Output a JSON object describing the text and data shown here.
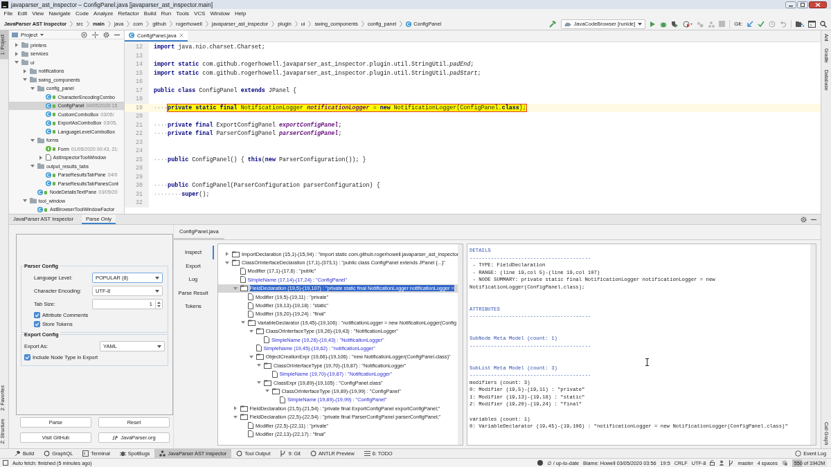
{
  "window": {
    "title": "javaparser_ast_inspector – ConfigPanel.java [javaparser_ast_inspector.main]"
  },
  "menu": [
    "File",
    "Edit",
    "View",
    "Navigate",
    "Code",
    "Analyze",
    "Refactor",
    "Build",
    "Run",
    "Tools",
    "VCS",
    "Window",
    "Help"
  ],
  "breadcrumb": [
    {
      "label": "JavaParser AST Inspector",
      "kind": "module",
      "bold": true
    },
    {
      "label": "src",
      "kind": "folder",
      "bold": false
    },
    {
      "label": "main",
      "kind": "folder",
      "bold": true
    },
    {
      "label": "java",
      "kind": "folder",
      "bold": false
    },
    {
      "label": "com",
      "kind": "folder",
      "bold": false
    },
    {
      "label": "github",
      "kind": "folder",
      "bold": false
    },
    {
      "label": "rogerhowell",
      "kind": "folder",
      "bold": false
    },
    {
      "label": "javaparser_ast_inspector",
      "kind": "folder",
      "bold": false
    },
    {
      "label": "plugin",
      "kind": "folder",
      "bold": false
    },
    {
      "label": "ui",
      "kind": "folder",
      "bold": false
    },
    {
      "label": "swing_components",
      "kind": "folder",
      "bold": false
    },
    {
      "label": "config_panel",
      "kind": "folder",
      "bold": false
    },
    {
      "label": "ConfigPanel",
      "kind": "class",
      "bold": false
    }
  ],
  "toolbar": {
    "run_config": "JavaCodeBrowser [runIde]",
    "git_label": "Git:"
  },
  "left_stripe": {
    "top": [
      {
        "label": "1: Project",
        "selected": true
      }
    ],
    "bottom": [
      {
        "label": "2: Favorites",
        "selected": false
      },
      {
        "label": "Z: Structure",
        "selected": false
      }
    ]
  },
  "right_stripe": {
    "top": [
      "Ant",
      "Gradle",
      "Database"
    ],
    "bottom": [
      "Call Graph"
    ]
  },
  "project": {
    "title": "Project",
    "tree": [
      {
        "name": "printers",
        "kind": "folder",
        "expanded": false,
        "selected": false
      },
      {
        "name": "services",
        "kind": "folder",
        "expanded": false,
        "selected": false
      },
      {
        "name": "ui",
        "kind": "folder",
        "expanded": true,
        "selected": false,
        "children": [
          {
            "name": "notifications",
            "kind": "folder",
            "expanded": false,
            "selected": false
          },
          {
            "name": "swing_components",
            "kind": "folder",
            "expanded": true,
            "selected": false,
            "children": [
              {
                "name": "config_panel",
                "kind": "folder",
                "expanded": true,
                "selected": false,
                "children": [
                  {
                    "name": "CharacterEncodingCombo",
                    "kind": "class",
                    "selected": false
                  },
                  {
                    "name": "ConfigPanel",
                    "meta": "04/05/2020 15",
                    "kind": "class",
                    "selected": true
                  },
                  {
                    "name": "CustomComboBox",
                    "meta": "03/05/",
                    "kind": "class",
                    "selected": false
                  },
                  {
                    "name": "ExportAsComboBox",
                    "meta": "03/05,",
                    "kind": "class",
                    "selected": false
                  },
                  {
                    "name": "LanguageLevelComboBox",
                    "kind": "class",
                    "selected": false
                  }
                ]
              },
              {
                "name": "forms",
                "kind": "folder",
                "expanded": true,
                "selected": false,
                "children": [
                  {
                    "name": "Form",
                    "meta": "01/05/2020 00:43, 21:",
                    "kind": "form",
                    "selected": false
                  },
                  {
                    "name": "AstInspectorToolWindow",
                    "kind": "file",
                    "expanded": false,
                    "selected": false
                  }
                ]
              },
              {
                "name": "output_results_tabs",
                "kind": "folder",
                "expanded": true,
                "selected": false,
                "children": [
                  {
                    "name": "ParseResultsTabPane",
                    "meta": "04/0",
                    "kind": "class",
                    "selected": false
                  },
                  {
                    "name": "ParseResultsTabPanesCont",
                    "kind": "class",
                    "selected": false
                  }
                ]
              },
              {
                "name": "NodeDetailsTextPane",
                "meta": "03/05/20",
                "kind": "class",
                "selected": false
              }
            ]
          },
          {
            "name": "tool_window",
            "kind": "folder",
            "expanded": true,
            "selected": false,
            "children": [
              {
                "name": "AstBrowserToolWindowFactor",
                "kind": "class",
                "selected": false
              }
            ]
          }
        ]
      }
    ]
  },
  "editor": {
    "tab": "ConfigPanel.java",
    "lines": [
      {
        "number": "12",
        "highlighted": false,
        "tokens": [
          {
            "kind": "keyword",
            "text": "import"
          },
          {
            "kind": "plain",
            "text": " java.nio.charset.Charset;"
          }
        ]
      },
      {
        "number": "13",
        "highlighted": false
      },
      {
        "number": "14",
        "highlighted": false,
        "tokens": [
          {
            "kind": "keyword",
            "text": "import static"
          },
          {
            "kind": "plain",
            "text": " com.github.rogerhowell.javaparser_ast_inspector.plugin.util.StringUtil."
          },
          {
            "kind": "static",
            "text": "padEnd"
          },
          {
            "kind": "plain",
            "text": ";"
          }
        ]
      },
      {
        "number": "15",
        "highlighted": false,
        "tokens": [
          {
            "kind": "keyword",
            "text": "import static"
          },
          {
            "kind": "plain",
            "text": " com.github.rogerhowell.javaparser_ast_inspector.plugin.util.StringUtil."
          },
          {
            "kind": "static",
            "text": "padStart"
          },
          {
            "kind": "plain",
            "text": ";"
          }
        ]
      },
      {
        "number": "16",
        "highlighted": false
      },
      {
        "number": "17",
        "highlighted": false,
        "tokens": [
          {
            "kind": "keyword",
            "text": "public class"
          },
          {
            "kind": "plain",
            "text": " ConfigPanel "
          },
          {
            "kind": "keyword",
            "text": "extends"
          },
          {
            "kind": "plain",
            "text": " JPanel {"
          }
        ]
      },
      {
        "number": "18",
        "highlighted": false
      },
      {
        "number": "19",
        "highlighted": true,
        "tokens": [
          {
            "kind": "indent",
            "text": "····"
          },
          {
            "kind": "keyword",
            "text": "private static final"
          },
          {
            "kind": "plain",
            "text": " NotificationLogger "
          },
          {
            "kind": "field",
            "text": "notificationLogger"
          },
          {
            "kind": "plain",
            "text": " = "
          },
          {
            "kind": "keyword",
            "text": "new"
          },
          {
            "kind": "plain",
            "text": " NotificationLogger(ConfigPanel."
          },
          {
            "kind": "keyword",
            "text": "class"
          },
          {
            "kind": "plain",
            "text": ");"
          }
        ]
      },
      {
        "number": "20",
        "highlighted": false
      },
      {
        "number": "21",
        "highlighted": false,
        "tokens": [
          {
            "kind": "indent",
            "text": "····"
          },
          {
            "kind": "keyword",
            "text": "private final"
          },
          {
            "kind": "plain",
            "text": " ExportConfigPanel "
          },
          {
            "kind": "field",
            "text": "exportConfigPanel"
          },
          {
            "kind": "plain",
            "text": ";"
          }
        ]
      },
      {
        "number": "22",
        "highlighted": false,
        "tokens": [
          {
            "kind": "indent",
            "text": "····"
          },
          {
            "kind": "keyword",
            "text": "private final"
          },
          {
            "kind": "plain",
            "text": " ParserConfigPanel "
          },
          {
            "kind": "field",
            "text": "parserConfigPanel"
          },
          {
            "kind": "plain",
            "text": ";"
          }
        ]
      },
      {
        "number": "23",
        "highlighted": false
      },
      {
        "number": "24",
        "highlighted": false
      },
      {
        "number": "25",
        "highlighted": false,
        "tokens": [
          {
            "kind": "indent",
            "text": "····"
          },
          {
            "kind": "keyword",
            "text": "public"
          },
          {
            "kind": "plain",
            "text": " ConfigPanel() { "
          },
          {
            "kind": "keyword",
            "text": "this"
          },
          {
            "kind": "plain",
            "text": "("
          },
          {
            "kind": "keyword",
            "text": "new"
          },
          {
            "kind": "plain",
            "text": " ParserConfiguration()); }"
          }
        ]
      },
      {
        "number": "28",
        "highlighted": false
      },
      {
        "number": "29",
        "highlighted": false
      },
      {
        "number": "30",
        "highlighted": false,
        "tokens": [
          {
            "kind": "indent",
            "text": "····"
          },
          {
            "kind": "keyword",
            "text": "public"
          },
          {
            "kind": "plain",
            "text": " ConfigPanel(ParserConfiguration parserConfiguration) {"
          }
        ]
      },
      {
        "number": "31",
        "highlighted": false,
        "tokens": [
          {
            "kind": "indent",
            "text": "········"
          },
          {
            "kind": "keyword",
            "text": "super"
          },
          {
            "kind": "plain",
            "text": "();"
          }
        ]
      },
      {
        "number": "32",
        "highlighted": false
      }
    ]
  },
  "tool_window": {
    "tabs": [
      {
        "label": "JavaParser AST Inspector",
        "selected": false
      },
      {
        "label": "Parse Only",
        "selected": true
      }
    ]
  },
  "config": {
    "groups": [
      {
        "title": "Parser Config",
        "kind": "parser",
        "fields": [
          {
            "kind": "dropdown",
            "label": "Language Level:",
            "value": "POPULAR (8)",
            "focused": true
          },
          {
            "kind": "dropdown",
            "label": "Character Encoding:",
            "value": "UTF-8",
            "focused": false
          },
          {
            "kind": "spinner",
            "label": "Tab Size:",
            "value": "1",
            "focused": false
          }
        ],
        "checkboxes": [
          {
            "label": "Attribute Comments",
            "checked": true
          },
          {
            "label": "Store Tokens",
            "checked": true
          }
        ]
      },
      {
        "title": "Export Config",
        "kind": "export",
        "fields": [
          {
            "kind": "dropdown",
            "label": "Export As:",
            "value": "YAML",
            "focused": false
          }
        ],
        "checkboxes": [
          {
            "label": "Include Node Type in Export",
            "checked": true
          }
        ]
      }
    ],
    "buttons": [
      {
        "label": "Parse",
        "has_icon": false
      },
      {
        "label": "Reset",
        "has_icon": false
      },
      {
        "label": "Visit GitHub",
        "has_icon": false
      },
      {
        "label": "JavaParser.org",
        "has_icon": true
      }
    ]
  },
  "inspector": {
    "file_tab": "ConfigPanel.java",
    "tabs": [
      {
        "label": "Inspect",
        "selected": true
      },
      {
        "label": "Export",
        "selected": false
      },
      {
        "label": "Log",
        "selected": false
      },
      {
        "label": "Parse Result",
        "selected": false
      },
      {
        "label": "Tokens",
        "selected": false
      }
    ],
    "tree": [
      {
        "label": "ImportDeclaration (15,1)-(15,94) : \"import static com.github.rogerhowell.javaparser_ast_inspector",
        "kind": "node",
        "expanded": false,
        "selected": false
      },
      {
        "label": "ClassOrInterfaceDeclaration (17,1)-(373,1) : \"public class ConfigPanel extends JPanel {...}\"",
        "kind": "node",
        "expanded": true,
        "selected": false,
        "children": [
          {
            "label": "Modifier (17,1)-(17,6) : \"public\"",
            "kind": "leaf",
            "selected": false
          },
          {
            "label": "SimpleName (17,14)-(17,24) : \"ConfigPanel\"",
            "kind": "name",
            "selected": false
          },
          {
            "label": "FieldDeclaration (19,5)-(19,107) : \"private static final NotificationLogger notificationLogger =",
            "kind": "node",
            "expanded": true,
            "selected": true,
            "children": [
              {
                "label": "Modifier (19,5)-(19,11) : \"private\"",
                "kind": "leaf",
                "selected": false
              },
              {
                "label": "Modifier (19,13)-(19,18) : \"static\"",
                "kind": "leaf",
                "selected": false
              },
              {
                "label": "Modifier (19,20)-(19,24) : \"final\"",
                "kind": "leaf",
                "selected": false
              },
              {
                "label": "VariableDeclarator (19,45)-(19,106) : \"notificationLogger = new NotificationLogger(Config",
                "kind": "node",
                "expanded": true,
                "selected": false,
                "children": [
                  {
                    "label": "ClassOrInterfaceType (19,26)-(19,43) : \"NotificationLogger\"",
                    "kind": "node",
                    "expanded": true,
                    "selected": false,
                    "children": [
                      {
                        "label": "SimpleName (19,26)-(19,43) : \"NotificationLogger\"",
                        "kind": "name",
                        "selected": false
                      }
                    ]
                  },
                  {
                    "label": "SimpleName (19,45)-(19,62) : \"notificationLogger\"",
                    "kind": "name",
                    "selected": false
                  },
                  {
                    "label": "ObjectCreationExpr (19,66)-(19,106) : \"new NotificationLogger(ConfigPanel.class)\"",
                    "kind": "node",
                    "expanded": true,
                    "selected": false,
                    "children": [
                      {
                        "label": "ClassOrInterfaceType (19,70)-(19,87) : \"NotificationLogger\"",
                        "kind": "node",
                        "expanded": true,
                        "selected": false,
                        "children": [
                          {
                            "label": "SimpleName (19,70)-(19,87) : \"NotificationLogger\"",
                            "kind": "name",
                            "selected": false
                          }
                        ]
                      },
                      {
                        "label": "ClassExpr (19,89)-(19,105) : \"ConfigPanel.class\"",
                        "kind": "node",
                        "expanded": true,
                        "selected": false,
                        "children": [
                          {
                            "label": "ClassOrInterfaceType (19,89)-(19,99) : \"ConfigPanel\"",
                            "kind": "node",
                            "expanded": true,
                            "selected": false,
                            "children": [
                              {
                                "label": "SimpleName (19,89)-(19,99) : \"ConfigPanel\"",
                                "kind": "name",
                                "selected": false
                              }
                            ]
                          }
                        ]
                      }
                    ]
                  }
                ]
              }
            ]
          },
          {
            "label": "FieldDeclaration (21,5)-(21,54) : \"private final ExportConfigPanel exportConfigPanel;\"",
            "kind": "node",
            "expanded": false,
            "selected": false
          },
          {
            "label": "FieldDeclaration (22,5)-(22,54) : \"private final ParserConfigPanel parserConfigPanel;\"",
            "kind": "node",
            "expanded": true,
            "selected": false,
            "children": [
              {
                "label": "Modifier (22,5)-(22,11) : \"private\"",
                "kind": "leaf",
                "selected": false
              },
              {
                "label": "Modifier (22,13)-(22,17) : \"final\"",
                "kind": "leaf",
                "selected": false
              }
            ]
          }
        ]
      }
    ],
    "details": [
      {
        "kind": "heading",
        "text": "DETAILS"
      },
      {
        "kind": "heading",
        "text": "----------------------------------------"
      },
      {
        "kind": "text",
        "text": " - TYPE: FieldDeclaration"
      },
      {
        "kind": "text",
        "text": " - RANGE: (line 19,col 5)-(line 19,col 107)"
      },
      {
        "kind": "text",
        "text": " - NODE SUMMARY: private static final NotificationLogger notificationLogger = new"
      },
      {
        "kind": "text",
        "text": "NotificationLogger(ConfigPanel.class);"
      },
      {
        "kind": "gap"
      },
      {
        "kind": "gap"
      },
      {
        "kind": "heading",
        "text": "ATTRIBUTES"
      },
      {
        "kind": "heading",
        "text": "----------------------------------------"
      },
      {
        "kind": "gap"
      },
      {
        "kind": "gap"
      },
      {
        "kind": "heading",
        "text": "SubNode Meta Model (count: 1)"
      },
      {
        "kind": "heading",
        "text": "----------------------------------------"
      },
      {
        "kind": "gap"
      },
      {
        "kind": "gap"
      },
      {
        "kind": "heading",
        "text": "SubList Meta Model (count: 3)"
      },
      {
        "kind": "heading",
        "text": "----------------------------------------"
      },
      {
        "kind": "text",
        "text": "modifiers (count: 3)"
      },
      {
        "kind": "text",
        "text": "0: Modifier (19,5)-(19,11) : \"private\""
      },
      {
        "kind": "text",
        "text": "1: Modifier (19,13)-(19,18) : \"static\""
      },
      {
        "kind": "text",
        "text": "2: Modifier (19,20)-(19,24) : \"final\""
      },
      {
        "kind": "gap"
      },
      {
        "kind": "text",
        "text": "variables (count: 1)"
      },
      {
        "kind": "text",
        "text": "0: VariableDeclarator (19,45)-(19,106) : \"notificationLogger = new NotificationLogger(ConfigPanel.class)\""
      }
    ]
  },
  "tool_tabs": [
    {
      "label": "Build",
      "selected": false
    },
    {
      "label": "GraphQL",
      "selected": false
    },
    {
      "label": "Terminal",
      "selected": false
    },
    {
      "label": "SpotBugs",
      "selected": false
    },
    {
      "label": "JavaParser AST Inspector",
      "selected": true
    },
    {
      "label": "Tool Output",
      "selected": false
    },
    {
      "label": "9: Git",
      "selected": false
    },
    {
      "label": "ANTLR Preview",
      "selected": false
    },
    {
      "label": "6: TODO",
      "selected": false
    }
  ],
  "event_log": "Event Log",
  "status_bar": {
    "message": "Auto fetch: finished (5 minutes ago)",
    "vcs": "∅ / up-to-date",
    "blame": "Blame: Howell 03/05/2020 03:56",
    "position": "19:5",
    "line_ending": "CRLF",
    "encoding": "UTF-8",
    "branch": "master",
    "indent": "4 spaces",
    "memory": {
      "text": "550 of 1942M",
      "level": 0.28
    }
  }
}
